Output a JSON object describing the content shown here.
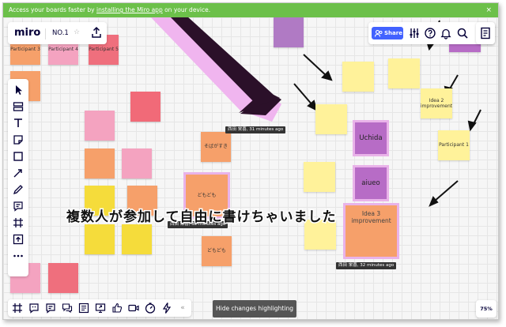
{
  "banner": {
    "prefix": "Access your boards faster by ",
    "link": "installing the Miro app",
    "suffix": " on your device."
  },
  "header": {
    "logo": "miro",
    "board_title": "NO.1",
    "share_label": "Share"
  },
  "notes": [
    {
      "text": "Participant 3",
      "color": "#f6a06a"
    },
    {
      "text": "Participant 4",
      "color": "#f4a3c0"
    },
    {
      "text": "Participant 5",
      "color": "#ef6f7d"
    },
    {
      "text": "",
      "color": "#f6a06a"
    },
    {
      "text": "そばがすき",
      "color": "#f6a06a"
    },
    {
      "text": "どもども",
      "color": "#f6a06a"
    },
    {
      "text": "どもども",
      "color": "#f6a06a"
    },
    {
      "text": "Uchida",
      "color": "#b76cc6"
    },
    {
      "text": "aiueo",
      "color": "#b76cc6"
    },
    {
      "text": "Idea 3 improvement",
      "color": "#f6a06a"
    },
    {
      "text": "Idea 2 improvement",
      "color": "#fff29a"
    },
    {
      "text": "Participant 1",
      "color": "#fff29a"
    }
  ],
  "labels": {
    "a": "西田 栄喜, 31 minutes ago",
    "b": "西田 栄喜, 32 minutes ago",
    "c": "西田 栄喜, 32 minutes ago"
  },
  "caption": "複数人が参加して自由に書けちゃいました",
  "hide_changes_label": "Hide changes highlighting",
  "zoom": "75%",
  "collapse_glyph": "«"
}
